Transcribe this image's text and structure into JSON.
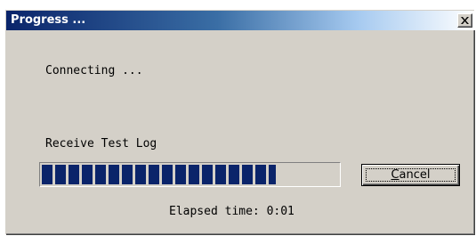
{
  "window": {
    "title": "Progress ...",
    "close_icon": "close-x-icon"
  },
  "status": {
    "connecting": "Connecting ...",
    "task": "Receive Test Log",
    "elapsed": "Elapsed time: 0:01"
  },
  "progress": {
    "percent": 79,
    "color": "#0a246a"
  },
  "buttons": {
    "cancel_accel": "C",
    "cancel_rest": "ancel"
  },
  "colors": {
    "face": "#d4d0c8",
    "title_active": "#0a246a"
  }
}
